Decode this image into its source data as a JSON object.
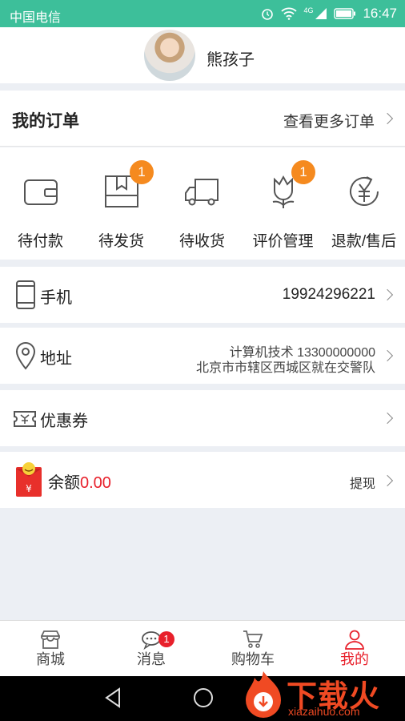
{
  "status_bar": {
    "carrier": "中国电信",
    "time": "16:47",
    "network": "4G"
  },
  "profile": {
    "name": "熊孩子"
  },
  "orders": {
    "title": "我的订单",
    "more": "查看更多订单",
    "items": [
      {
        "label": "待付款",
        "icon": "wallet-icon"
      },
      {
        "label": "待发货",
        "icon": "package-icon",
        "badge": "1"
      },
      {
        "label": "待收货",
        "icon": "truck-icon"
      },
      {
        "label": "评价管理",
        "icon": "flower-icon",
        "badge": "1"
      },
      {
        "label": "退款/售后",
        "icon": "refund-icon"
      }
    ]
  },
  "phone": {
    "label": "手机",
    "value": "19924296221"
  },
  "address": {
    "label": "地址",
    "line1": "计算机技术  13300000000",
    "line2": "北京市市辖区西城区就在交警队"
  },
  "coupon": {
    "label": "优惠券"
  },
  "balance": {
    "label": "余额",
    "amount": "0.00",
    "action": "提现"
  },
  "tabs": [
    {
      "label": "商城",
      "icon": "store-icon"
    },
    {
      "label": "消息",
      "icon": "chat-icon",
      "badge": "1"
    },
    {
      "label": "购物车",
      "icon": "cart-icon"
    },
    {
      "label": "我的",
      "icon": "user-icon",
      "active": true
    }
  ],
  "watermark": {
    "text": "下载火",
    "sub": "xiazaihuo.com"
  },
  "colors": {
    "status_bar": "#3dbf9a",
    "accent_red": "#e8202b",
    "badge_orange": "#f58a1f"
  }
}
